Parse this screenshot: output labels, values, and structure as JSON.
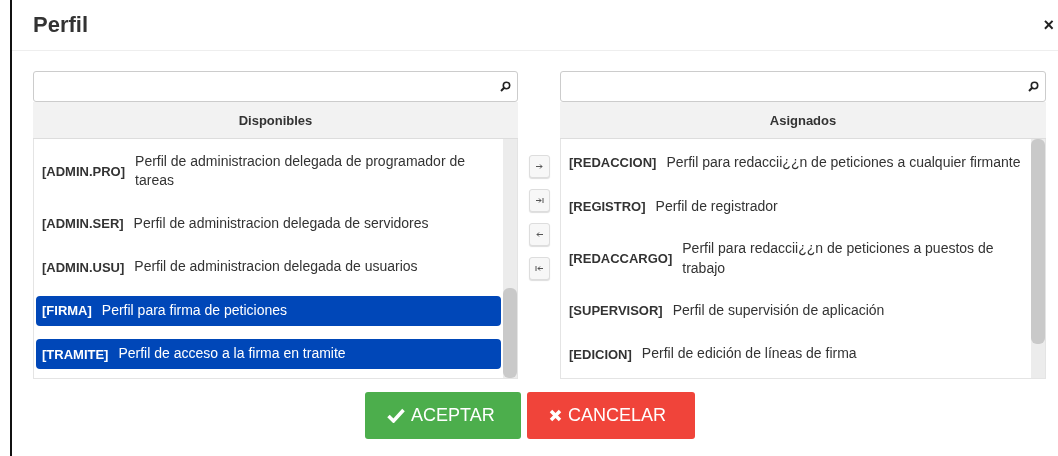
{
  "dialog": {
    "title": "Perfil",
    "close": "×"
  },
  "available": {
    "header": "Disponibles",
    "items": [
      {
        "code": "[ADMIN.PRO]",
        "description": "Perfil de administracion delegada de programador de tareas",
        "selected": false
      },
      {
        "code": "[ADMIN.SER]",
        "description": "Perfil de administracion delegada de servidores",
        "selected": false
      },
      {
        "code": "[ADMIN.USU]",
        "description": "Perfil de administracion delegada de usuarios",
        "selected": false
      },
      {
        "code": "[FIRMA]",
        "description": "Perfil para firma de peticiones",
        "selected": true
      },
      {
        "code": "[TRAMITE]",
        "description": "Perfil de acceso a la firma en tramite",
        "selected": true
      }
    ]
  },
  "assigned": {
    "header": "Asignados",
    "items": [
      {
        "code": "[REDACCION]",
        "description": "Perfil para redaccii¿¿n de peticiones a cualquier firmante",
        "selected": false
      },
      {
        "code": "[REGISTRO]",
        "description": "Perfil de registrador",
        "selected": false
      },
      {
        "code": "[REDACCARGO]",
        "description": "Perfil para redaccii¿¿n de peticiones a puestos de trabajo",
        "selected": false
      },
      {
        "code": "[SUPERVISOR]",
        "description": "Perfil de supervisión de aplicación",
        "selected": false
      },
      {
        "code": "[EDICION]",
        "description": "Perfil de edición de líneas de firma",
        "selected": false
      }
    ]
  },
  "buttons": [
    {
      "kind": "accept",
      "label": "ACEPTAR"
    },
    {
      "kind": "cancel",
      "label": "CANCELAR"
    }
  ]
}
